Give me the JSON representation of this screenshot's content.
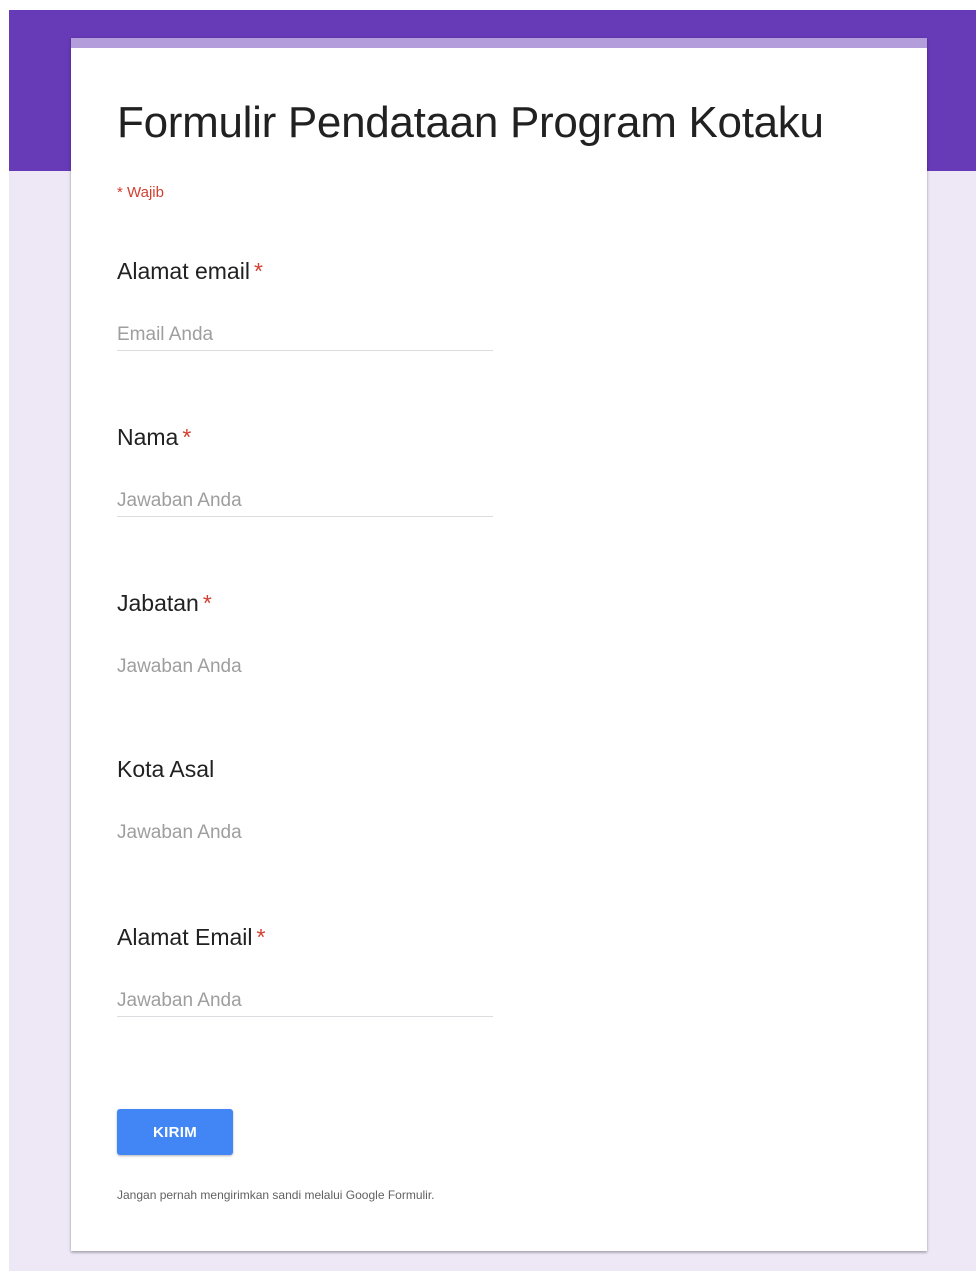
{
  "form": {
    "title": "Formulir Pendataan Program Kotaku",
    "required_note": "* Wajib",
    "questions": [
      {
        "label": "Alamat email",
        "required_mark": "*",
        "placeholder": "Email Anda"
      },
      {
        "label": "Nama",
        "required_mark": "*",
        "placeholder": "Jawaban Anda"
      },
      {
        "label": "Jabatan",
        "required_mark": "*",
        "placeholder": "Jawaban Anda"
      },
      {
        "label": "Kota Asal",
        "required_mark": "",
        "placeholder": "Jawaban Anda"
      },
      {
        "label": "Alamat Email",
        "required_mark": "*",
        "placeholder": "Jawaban Anda"
      }
    ],
    "submit_label": "KIRIM",
    "footer_note": "Jangan pernah mengirimkan sandi melalui Google Formulir."
  },
  "colors": {
    "header": "#673ab7",
    "background": "#ede7f6",
    "accent": "#b39ddb",
    "required": "#d23f31",
    "button": "#4285f4"
  }
}
